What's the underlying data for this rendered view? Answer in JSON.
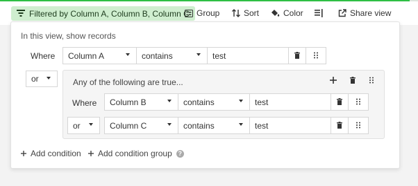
{
  "toolbar": {
    "filter_label": "Filtered by Column A, Column B, Column C",
    "group_label": "Group",
    "sort_label": "Sort",
    "color_label": "Color",
    "share_label": "Share view"
  },
  "panel": {
    "hint": "In this view, show records",
    "where_label": "Where",
    "condition1": {
      "field": "Column A",
      "operator": "contains",
      "value": "test"
    },
    "group_conjunction": "or",
    "group": {
      "title": "Any of the following are true...",
      "where_label": "Where",
      "condition1": {
        "field": "Column B",
        "operator": "contains",
        "value": "test"
      },
      "conjunction": "or",
      "condition2": {
        "field": "Column C",
        "operator": "contains",
        "value": "test"
      }
    },
    "add_condition": "Add condition",
    "add_condition_group": "Add condition group"
  }
}
